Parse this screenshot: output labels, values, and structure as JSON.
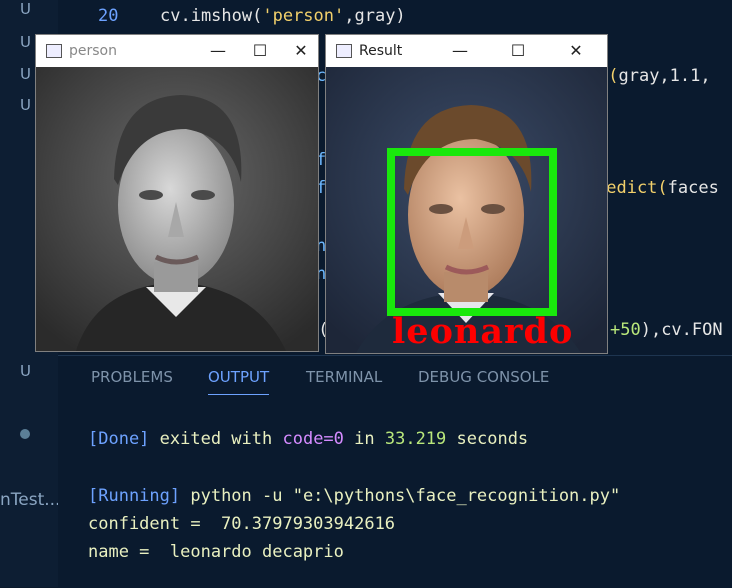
{
  "sidebar": {
    "git_marks": [
      "U",
      "U",
      "U",
      "U",
      "U"
    ],
    "label": "nTest..."
  },
  "editor": {
    "line_number": "20",
    "line20": {
      "prefix": "cv.imshow(",
      "str": "'person'",
      "suffix": ",gray)"
    },
    "frag_a": {
      "fn": "e(",
      "rest": "gray,1.1,"
    },
    "frag_b": {
      "fn": "redict(",
      "rest": "faces"
    },
    "frag_c": {
      "num": "+50",
      "rest": "),cv.FON"
    },
    "bg_chars": [
      "c",
      "f",
      "f",
      "n",
      "n",
      "t("
    ]
  },
  "windows": {
    "person": {
      "title": "person"
    },
    "result": {
      "title": "Result",
      "label": "leonardo"
    }
  },
  "window_controls": {
    "minimize": "—",
    "maximize": "☐",
    "close": "✕"
  },
  "panel": {
    "tabs": [
      "PROBLEMS",
      "OUTPUT",
      "TERMINAL",
      "DEBUG CONSOLE"
    ],
    "active_tab": "OUTPUT",
    "done": {
      "tag": "[Done]",
      "text1": " exited with ",
      "code": "code=0",
      "text2": " in ",
      "time": "33.219",
      "text3": " seconds"
    },
    "running": {
      "tag": "[Running]",
      "cmd": " python -u \"e:\\pythons\\face_recognition.py\""
    },
    "confident": "confident =  70.37979303942616",
    "name": "name =  leonardo decaprio"
  },
  "colors": {
    "accent": "#6da2ff",
    "face_box": "#19e80c",
    "label_red": "#ff0000"
  }
}
